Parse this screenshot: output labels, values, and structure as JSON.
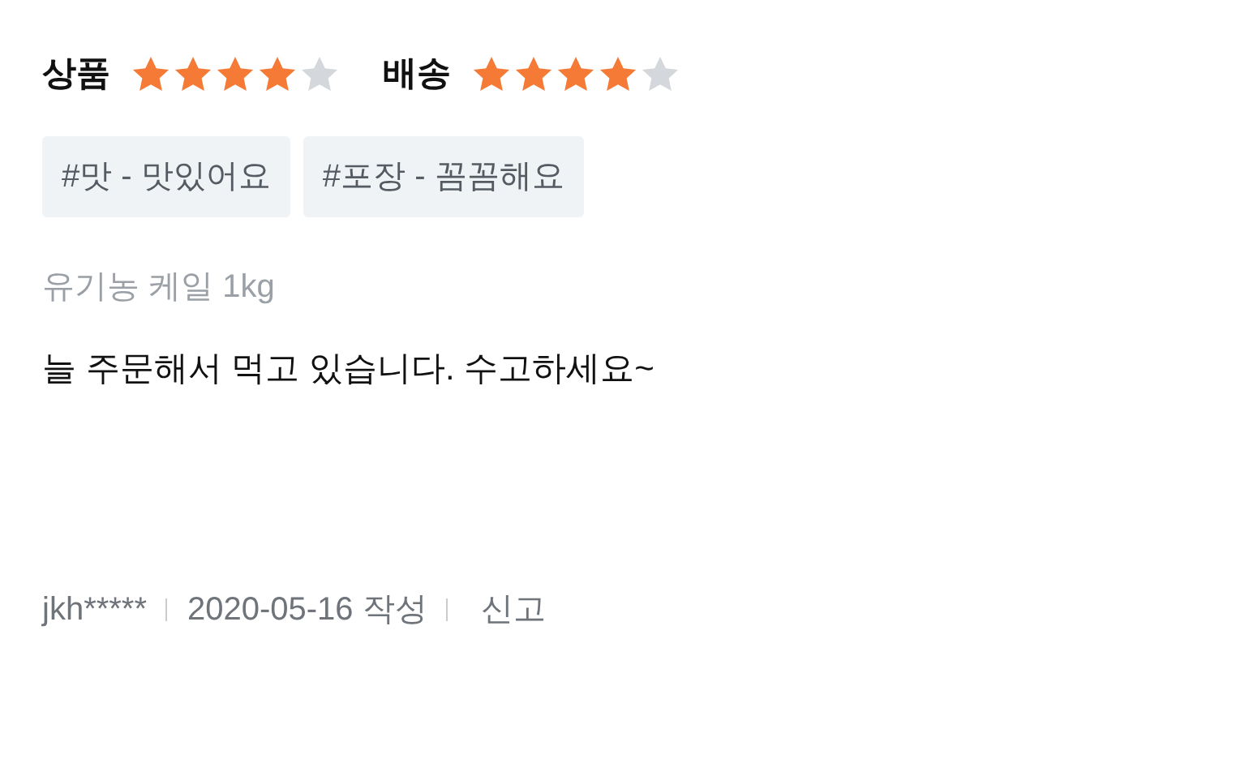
{
  "ratings": [
    {
      "label": "상품",
      "stars": 4
    },
    {
      "label": "배송",
      "stars": 4
    }
  ],
  "tags": [
    "#맛 - 맛있어요",
    "#포장 - 꼼꼼해요"
  ],
  "product": "유기농 케일 1kg",
  "review": "늘 주문해서 먹고 있습니다. 수고하세요~",
  "footer": {
    "author": "jkh*****",
    "date": "2020-05-16 작성",
    "report": "신고"
  }
}
